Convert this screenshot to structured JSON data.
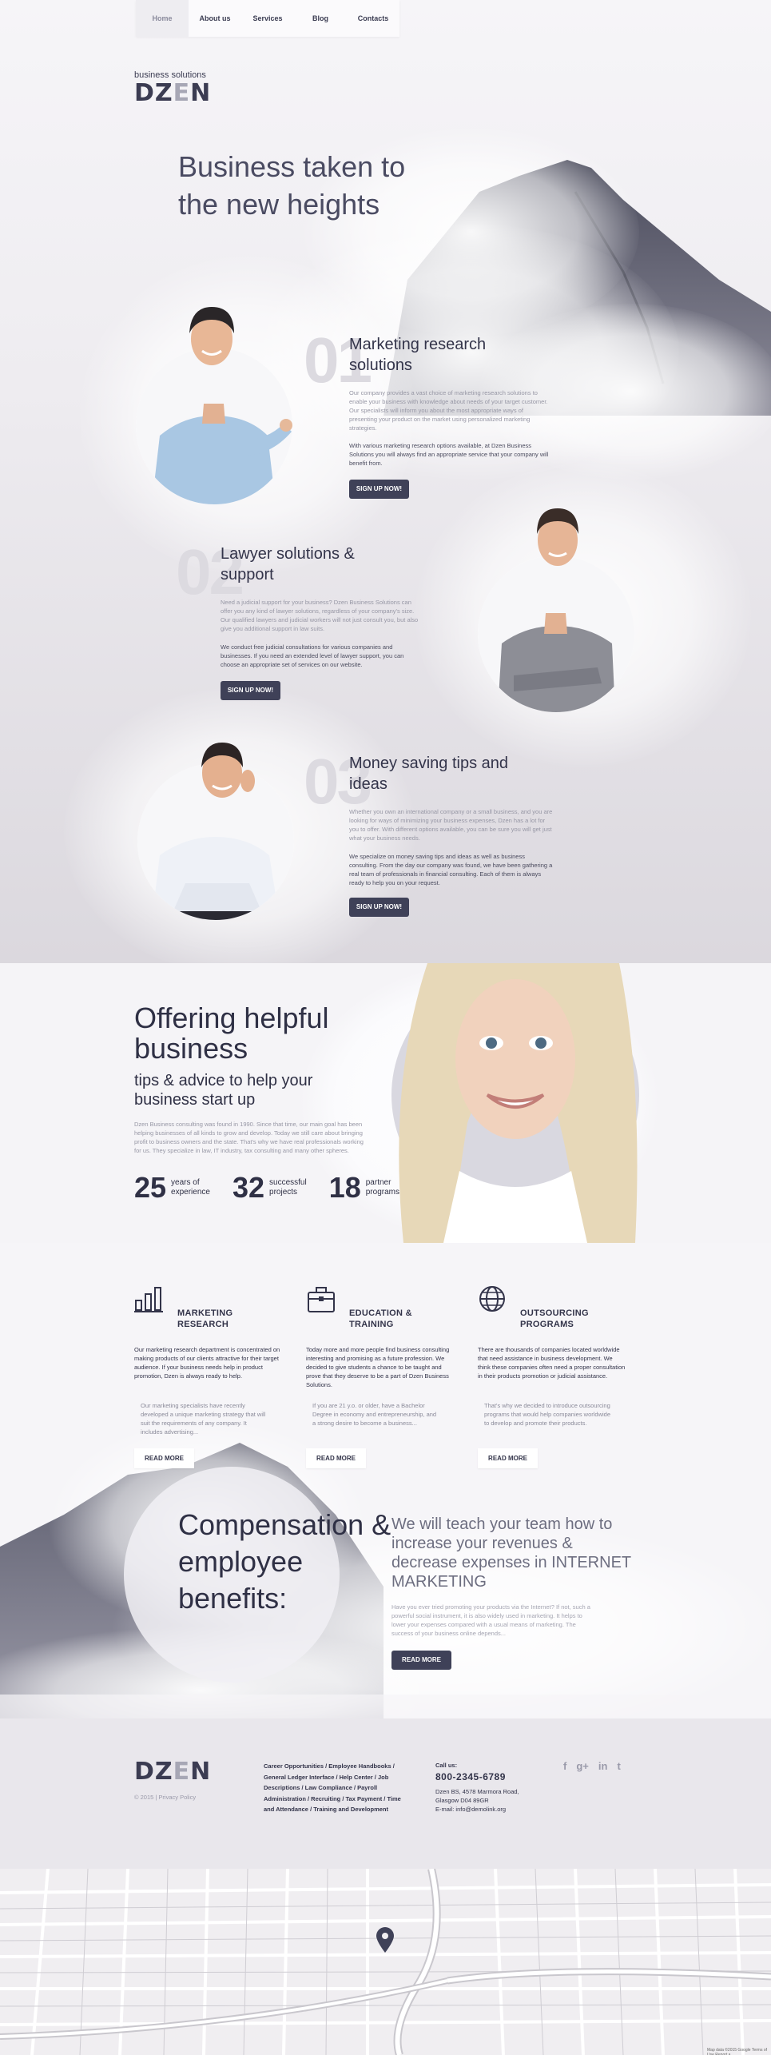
{
  "nav": {
    "items": [
      "Home",
      "About us",
      "Services",
      "Blog",
      "Contacts"
    ]
  },
  "brand": {
    "sub": "business solutions",
    "word_start": "DZ",
    "word_e": "E",
    "word_end": "N"
  },
  "hero": {
    "title": "Business taken to the new heights"
  },
  "services": [
    {
      "num": "01",
      "title": "Marketing research solutions",
      "text": "Our company provides a vast choice of marketing research solutions to enable your business with knowledge about needs of your target customer. Our specialists will inform you about the most appropriate ways of presenting your product on the market using personalized marketing strategies.",
      "text2": "With various marketing research options available, at Dzen Business Solutions you will always find an appropriate service that your company will benefit from.",
      "button": "SIGN UP NOW!"
    },
    {
      "num": "02",
      "title": "Lawyer solutions & support",
      "text": "Need a judicial support for your business? Dzen Business Solutions can offer you any kind of lawyer solutions, regardless of your company's size. Our qualified lawyers and judicial workers will not just consult you, but also give you additional support in law suits.",
      "text2": "We conduct free judicial consultations for various companies and businesses. If you need an extended level of lawyer support, you can choose an appropriate set of services on our website.",
      "button": "SIGN UP NOW!"
    },
    {
      "num": "03",
      "title": "Money saving tips and ideas",
      "text": "Whether you own an international company or a small business, and you are looking for ways of minimizing your business expenses, Dzen has a lot for you to offer. With different options available, you can be sure you will get just what your business needs.",
      "text2": "We specialize on money saving tips and ideas as well as business consulting. From the day our company was found, we have been gathering a real team of professionals in financial consulting. Each of them is always ready to help you on your request.",
      "button": "SIGN UP NOW!"
    }
  ],
  "offer": {
    "title": "Offering helpful business",
    "subtitle": "tips & advice to help your business start up",
    "text": "Dzen Business consulting was found in 1990. Since that time, our main goal has been helping businesses of all kinds to grow and develop. Today we still care about bringing profit to business owners and the state. That's why we have real professionals working for us. They specialize in law, IT industry, tax consulting and many other spheres.",
    "stats": [
      {
        "num": "25",
        "label1": "years of",
        "label2": "experience"
      },
      {
        "num": "32",
        "label1": "successful",
        "label2": "projects"
      },
      {
        "num": "18",
        "label1": "partner",
        "label2": "programs"
      }
    ]
  },
  "features": [
    {
      "icon": "bar-chart-icon",
      "title1": "MARKETING",
      "title2": "RESEARCH",
      "t1": "Our marketing research department is concentrated on making products of our clients attractive for their target audience. If your business needs help in product promotion, Dzen is always ready to help.",
      "t2": "Our marketing specialists have recently developed a unique marketing strategy that will suit the requirements of any company. It includes advertising...",
      "button": "READ MORE"
    },
    {
      "icon": "briefcase-icon",
      "title1": "EDUCATION &",
      "title2": "TRAINING",
      "t1": "Today more and more people find business consulting interesting and promising as a future profession. We decided to give students a chance to be taught and prove that they deserve to be a part of Dzen Business Solutions.",
      "t2": "If you are 21 y.o. or older, have a Bachelor Degree in economy and entrepreneurship, and a strong desire to become a business...",
      "button": "READ MORE"
    },
    {
      "icon": "globe-icon",
      "title1": "OUTSOURCING",
      "title2": "PROGRAMS",
      "t1": "There are thousands of companies located worldwide that need assistance in business development. We think these companies often need a proper consultation in their products promotion or judicial assistance.",
      "t2": "That's why we decided to introduce outsourcing programs that would help companies worldwide to develop and promote their products.",
      "button": "READ MORE"
    }
  ],
  "comp": {
    "title": "Compensation & employee benefits:",
    "subtitle": "We will teach your team how to increase your revenues & decrease expenses in INTERNET MARKETING",
    "text": "Have you ever tried promoting your products via the Internet? If not, such a powerful social instrument, it is also widely used in marketing. It helps to lower your expenses compared with a usual means of marketing. The success of your business online depends...",
    "button": "READ MORE"
  },
  "footer": {
    "copyright": "© 2015 | Privacy Policy",
    "links": "Career Opportunities / Employee Handbooks / General Ledger Interface / Help Center / Job Descriptions / Law Compliance / Payroll Administration / Recruiting / Tax Payment / Time and Attendance / Training and Development",
    "call_label": "Call us:",
    "phone": "800-2345-6789",
    "address1": "Dzen BS, 4578 Marmora Road,",
    "address2": "Glasgow D04 89GR",
    "email": "E-mail: info@demolink.org",
    "social": [
      "f",
      "g+",
      "in",
      "t"
    ]
  },
  "map": {
    "attribution": "Map data ©2015 Google   Terms of Use   Report a"
  },
  "colors": {
    "primary": "#3f4158",
    "background": "#f2f0f3",
    "footer": "#e9e7ec"
  }
}
